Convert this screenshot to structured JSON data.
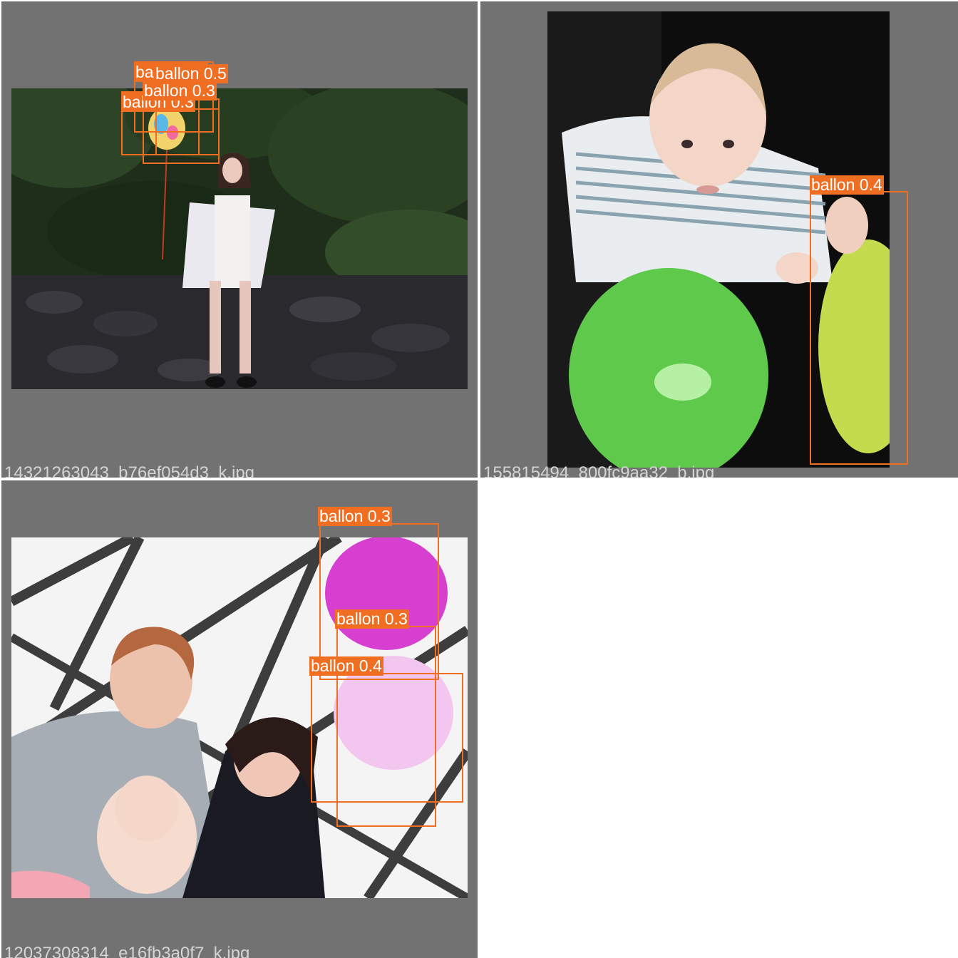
{
  "colors": {
    "box": "#f06e22",
    "background": "#727272",
    "filename_text": "#d4d4d4"
  },
  "tiles": [
    {
      "filename": "14321263043_b76ef054d3_k.jpg",
      "detections": [
        {
          "label": "ballon 0.5"
        },
        {
          "label": "ballon 0.3"
        },
        {
          "label": "ballon 0.3"
        },
        {
          "label": "ballon 0.5"
        }
      ]
    },
    {
      "filename": "155815494_800fc9aa32_b.jpg",
      "detections": [
        {
          "label": "ballon 0.4"
        }
      ]
    },
    {
      "filename": "12037308314_e16fb3a0f7_k.jpg",
      "detections": [
        {
          "label": "ballon 0.3"
        },
        {
          "label": "ballon 0.3"
        },
        {
          "label": "ballon 0.4"
        }
      ]
    }
  ]
}
